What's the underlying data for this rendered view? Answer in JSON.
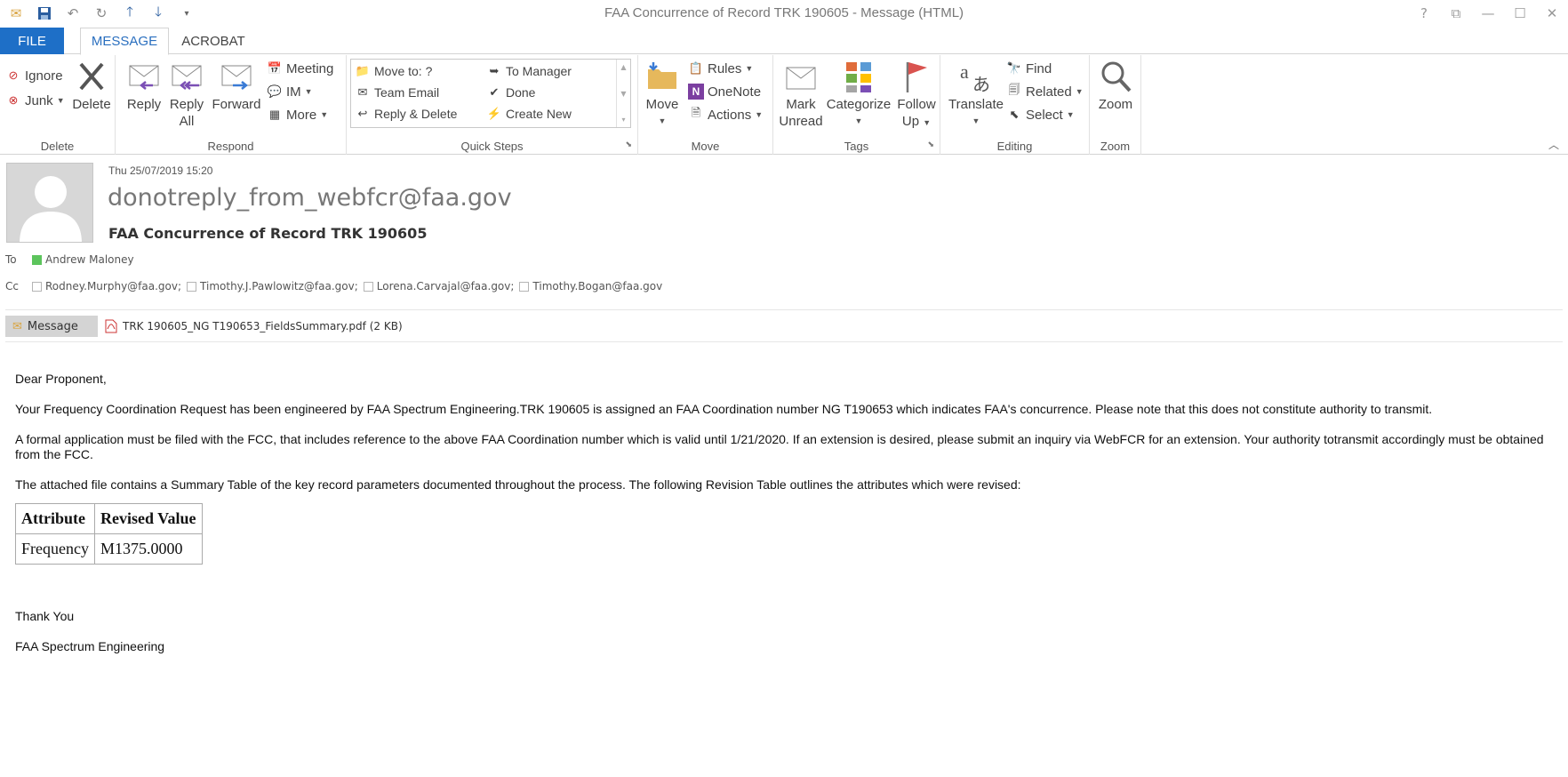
{
  "window": {
    "title": "FAA Concurrence of Record TRK 190605 - Message (HTML)",
    "controls": [
      "?",
      "⧉",
      "—",
      "☐",
      "✕"
    ]
  },
  "qat": [
    "mail-icon",
    "save-icon",
    "undo-icon",
    "redo-icon",
    "up-arrow-icon",
    "down-arrow-icon",
    "customize-icon"
  ],
  "tabs": {
    "file": "FILE",
    "message": "MESSAGE",
    "acrobat": "ACROBAT"
  },
  "ribbon": {
    "delete": {
      "label": "Delete",
      "ignore": "Ignore",
      "junk": "Junk",
      "delete_btn": "Delete"
    },
    "respond": {
      "label": "Respond",
      "reply": "Reply",
      "reply_all_1": "Reply",
      "reply_all_2": "All",
      "forward": "Forward",
      "meeting": "Meeting",
      "im": "IM",
      "more": "More"
    },
    "quick_steps": {
      "label": "Quick Steps",
      "move_to": "Move to: ?",
      "team_email": "Team Email",
      "reply_delete": "Reply & Delete",
      "to_manager": "To Manager",
      "done": "Done",
      "create_new": "Create New"
    },
    "move": {
      "label": "Move",
      "move_btn": "Move",
      "rules": "Rules",
      "onenote": "OneNote",
      "actions": "Actions"
    },
    "tags": {
      "label": "Tags",
      "mark_unread_1": "Mark",
      "mark_unread_2": "Unread",
      "categorize": "Categorize",
      "follow_up_1": "Follow",
      "follow_up_2": "Up"
    },
    "editing": {
      "label": "Editing",
      "translate": "Translate",
      "find": "Find",
      "related": "Related",
      "select": "Select"
    },
    "zoom": {
      "label": "Zoom",
      "zoom_btn": "Zoom"
    }
  },
  "message": {
    "date": "Thu 25/07/2019 15:20",
    "sender": "donotreply_from_webfcr@faa.gov",
    "subject": "FAA Concurrence of Record TRK 190605",
    "to_label": "To",
    "to": "Andrew Maloney",
    "cc_label": "Cc",
    "cc": [
      "Rodney.Murphy@faa.gov;",
      "Timothy.J.Pawlowitz@faa.gov;",
      "Lorena.Carvajal@faa.gov;",
      "Timothy.Bogan@faa.gov"
    ],
    "message_tab": "Message",
    "attachment": "TRK 190605_NG T190653_FieldsSummary.pdf (2 KB)"
  },
  "body": {
    "greeting": "Dear Proponent,",
    "p1": "Your Frequency Coordination Request has been engineered by FAA Spectrum Engineering.TRK 190605 is assigned an FAA Coordination number NG T190653 which indicates FAA's concurrence. Please note that this does not constitute authority to transmit.",
    "p2": "A formal application must be filed with the FCC, that includes reference to the above FAA Coordination number which is valid until 1/21/2020. If an extension is desired, please submit an inquiry via WebFCR for an extension. Your authority totransmit accordingly must be obtained from the FCC.",
    "p3": "The attached file contains a Summary Table of the key record parameters documented throughout the process. The following Revision Table outlines the attributes which were revised:",
    "table": {
      "headers": [
        "Attribute",
        "Revised Value"
      ],
      "rows": [
        [
          "Frequency",
          "M1375.0000"
        ]
      ]
    },
    "thanks": "Thank You",
    "signature": "FAA Spectrum Engineering"
  }
}
